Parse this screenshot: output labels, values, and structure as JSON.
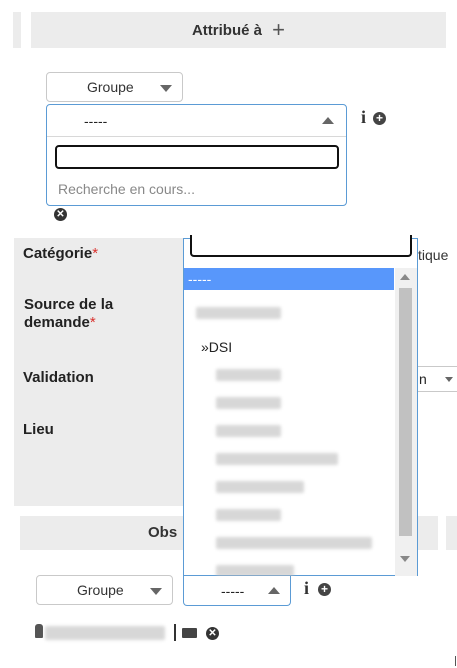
{
  "header": {
    "title": "Attribué à",
    "add_symbol": "+"
  },
  "assign": {
    "type_select": "Groupe",
    "actor_select": {
      "value": "-----",
      "search_placeholder": "",
      "status": "Recherche en cours..."
    },
    "info_symbol": "i"
  },
  "fields": {
    "category": "Catégorie",
    "source": "Source de la demande",
    "validation": "Validation",
    "location": "Lieu",
    "required_mark": "*",
    "right_fragments": {
      "category": "tique",
      "validation": "n"
    }
  },
  "dropdown": {
    "highlighted": "-----",
    "entity": "»DSI"
  },
  "observer": {
    "title_fragment": "Obs",
    "type_select": "Groupe",
    "actor_select": "-----",
    "info_symbol": "i"
  },
  "colors": {
    "focus_border": "#5b9bd5",
    "highlight": "#5897fb",
    "band": "#ececec",
    "required": "#d9302c"
  }
}
